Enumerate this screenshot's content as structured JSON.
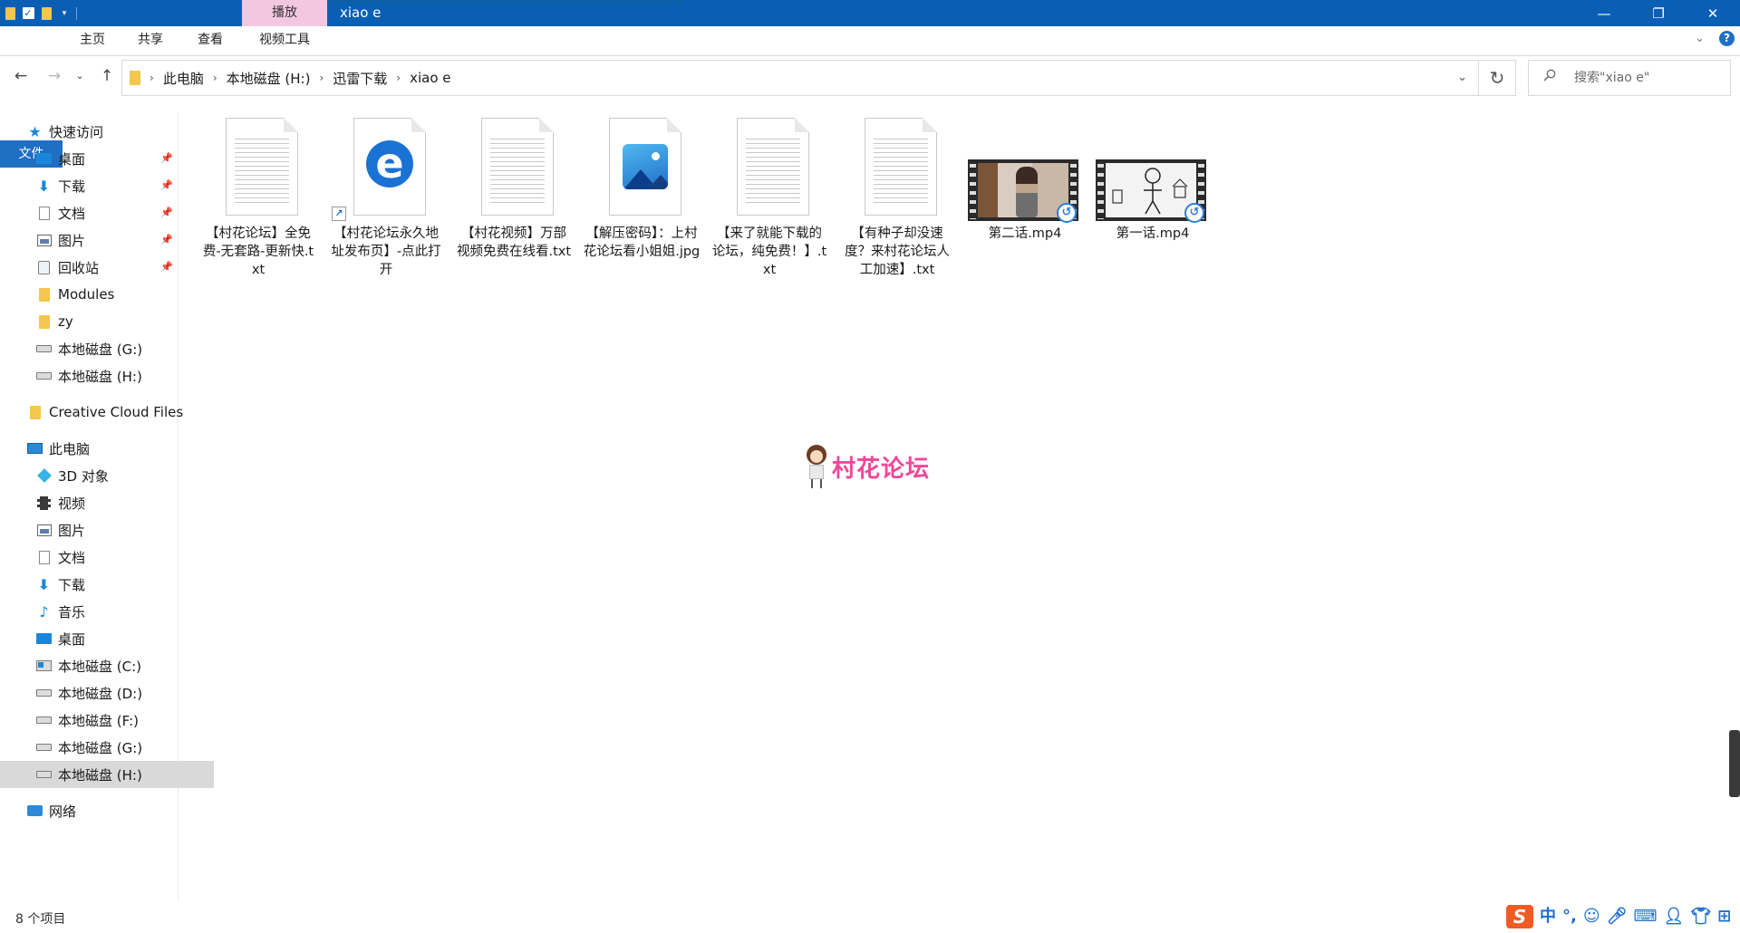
{
  "window": {
    "title": "xiao e",
    "context_tab": "播放"
  },
  "ribbon": {
    "tabs": [
      "文件",
      "主页",
      "共享",
      "查看",
      "视频工具"
    ]
  },
  "address": {
    "crumbs": [
      "此电脑",
      "本地磁盘 (H:)",
      "迅雷下载",
      "xiao e"
    ]
  },
  "search": {
    "placeholder": "搜索\"xiao e\""
  },
  "sidebar": {
    "quick_access": "快速访问",
    "quick_items": [
      "桌面",
      "下载",
      "文档",
      "图片",
      "回收站",
      "Modules",
      "zy",
      "本地磁盘 (G:)",
      "本地磁盘 (H:)"
    ],
    "creative_cloud": "Creative Cloud Files",
    "this_pc": "此电脑",
    "pc_items": [
      "3D 对象",
      "视频",
      "图片",
      "文档",
      "下载",
      "音乐",
      "桌面",
      "本地磁盘 (C:)",
      "本地磁盘 (D:)",
      "本地磁盘 (F:)",
      "本地磁盘 (G:)",
      "本地磁盘 (H:)"
    ],
    "network": "网络",
    "selected": "本地磁盘 (H:)"
  },
  "files": [
    {
      "name": "【村花论坛】全免费-无套路-更新快.txt",
      "type": "txt"
    },
    {
      "name": "【村花论坛永久地址发布页】-点此打开",
      "type": "url-shortcut"
    },
    {
      "name": "【村花视频】万部视频免费在线看.txt",
      "type": "txt"
    },
    {
      "name": "【解压密码】：上村花论坛看小姐姐.jpg",
      "type": "jpg"
    },
    {
      "name": "【来了就能下载的论坛，纯免费！】.txt",
      "type": "txt"
    },
    {
      "name": "【有种子却没速度？来村花论坛人工加速】.txt",
      "type": "txt"
    },
    {
      "name": "第二话.mp4",
      "type": "mp4"
    },
    {
      "name": "第一话.mp4",
      "type": "mp4"
    }
  ],
  "watermark": "村花论坛",
  "status": {
    "item_count": "8 个项目"
  },
  "tray": {
    "ime_logo": "S",
    "ime_lang": "中"
  }
}
